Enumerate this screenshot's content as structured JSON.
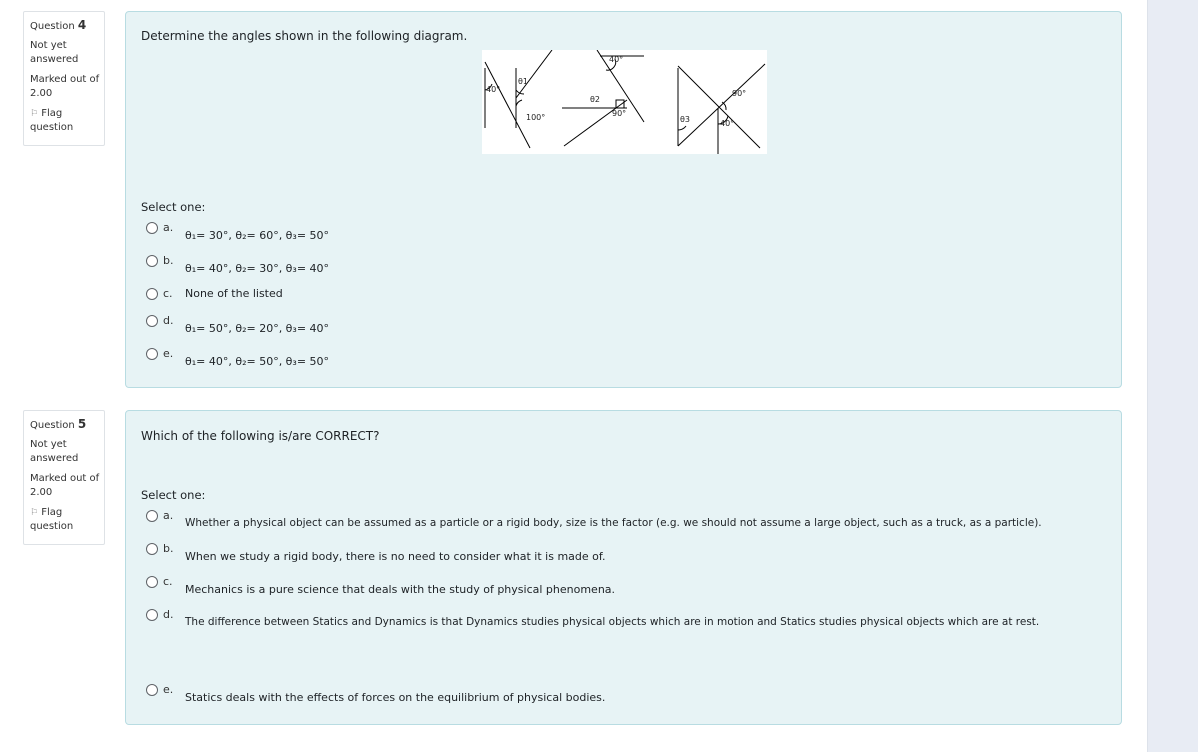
{
  "questions": [
    {
      "label": "Question",
      "number": "4",
      "state": "Not yet answered",
      "grade": "Marked out of 2.00",
      "flag": "Flag question",
      "text": "Determine the angles shown in the following diagram.",
      "select_prompt": "Select one:",
      "diagram_labels": {
        "a1": "40°",
        "t1": "θ1",
        "a2": "100°",
        "a3": "40°",
        "t2": "θ2",
        "a4": "90°",
        "t3": "θ3",
        "a5": "90°",
        "a6": "40°"
      },
      "options": [
        {
          "letter": "a.",
          "text": "θ₁= 30°, θ₂= 60°, θ₃= 50°"
        },
        {
          "letter": "b.",
          "text": "θ₁= 40°, θ₂= 30°, θ₃= 40°"
        },
        {
          "letter": "c.",
          "text": "None of the listed"
        },
        {
          "letter": "d.",
          "text": "θ₁= 50°, θ₂= 20°, θ₃= 40°"
        },
        {
          "letter": "e.",
          "text": "θ₁= 40°, θ₂= 50°, θ₃= 50°"
        }
      ]
    },
    {
      "label": "Question",
      "number": "5",
      "state": "Not yet answered",
      "grade": "Marked out of 2.00",
      "flag": "Flag question",
      "text": "Which of the following is/are CORRECT?",
      "select_prompt": "Select one:",
      "options": [
        {
          "letter": "a.",
          "text": "Whether a physical object can be assumed as a particle or a rigid body, size is the factor (e.g. we should not assume a large object, such as a truck, as a particle)."
        },
        {
          "letter": "b.",
          "text": "When we study a rigid body, there is no need to consider what it is made of."
        },
        {
          "letter": "c.",
          "text": "Mechanics is a pure science that deals with the study of physical phenomena."
        },
        {
          "letter": "d.",
          "text": "The difference between Statics and Dynamics is that Dynamics studies physical objects which are in motion and Statics studies physical objects which are at rest."
        },
        {
          "letter": "e.",
          "text": "Statics deals with the effects of forces on the equilibrium of physical bodies."
        }
      ]
    }
  ]
}
